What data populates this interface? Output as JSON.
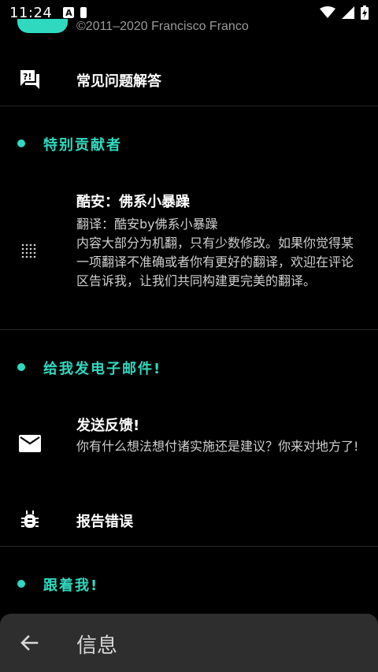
{
  "status_bar": {
    "time": "11:24",
    "icons": [
      "a-notification-icon",
      "sim-card-icon",
      "wifi-icon",
      "signal-icon",
      "battery-charging-icon"
    ]
  },
  "about": {
    "copyright": "©2011–2020 Francisco Franco"
  },
  "faq": {
    "label": "常见问题解答",
    "icon": "faq-icon"
  },
  "sections": {
    "contributors": "特别贡献者",
    "email": "给我发电子邮件!",
    "follow": "跟着我!"
  },
  "contributor": {
    "name": "酷安：佛系小暴躁",
    "translator": "翻译：酷安by佛系小暴躁",
    "note": "内容大部分为机翻，只有少数修改。如果你觉得某一项翻译不准确或者你有更好的翻译，欢迎在评论区告诉我，让我们共同构建更完美的翻译。",
    "icon": "dot-grid-icon"
  },
  "feedback": {
    "title": "发送反馈!",
    "subtitle": "你有什么想法想付诸实施还是建议？你来对地方了!",
    "icon": "mail-icon"
  },
  "bug": {
    "label": "报告错误",
    "icon": "bug-icon"
  },
  "bottom_bar": {
    "title": "信息",
    "back_icon": "back-arrow-icon"
  },
  "colors": {
    "accent": "#2fd9c0",
    "background": "#000000",
    "bottom_bar": "#2e2e2e"
  }
}
